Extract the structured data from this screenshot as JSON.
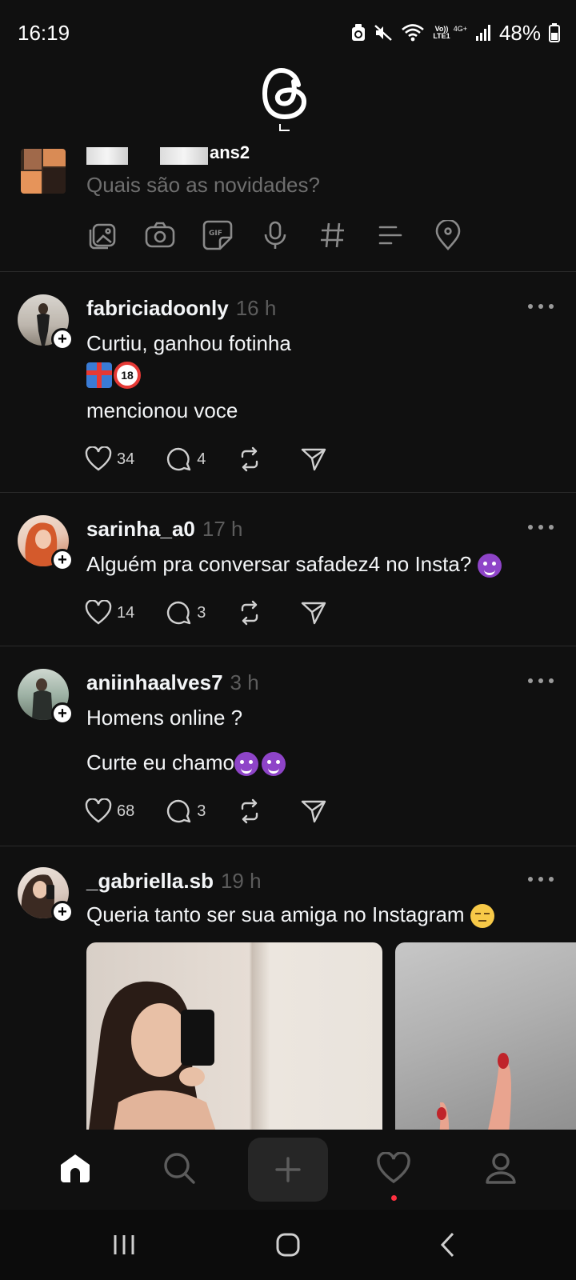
{
  "status_bar": {
    "time": "16:19",
    "network_volte": "Vo))",
    "network_lte": "LTE1",
    "network_4g": "4G+",
    "battery": "48%",
    "icons": [
      "usb-debug-icon",
      "mute-icon",
      "wifi-icon",
      "signal-icon",
      "battery-icon"
    ]
  },
  "app": {
    "logo": "threads-logo"
  },
  "composer": {
    "username_suffix": "ans2",
    "placeholder": "Quais são as novidades?",
    "tools": [
      "image-icon",
      "camera-icon",
      "gif-icon",
      "mic-icon",
      "hashtag-icon",
      "poll-icon",
      "location-icon"
    ]
  },
  "posts": [
    {
      "username": "fabriciadoonly",
      "time": "16 h",
      "lines": [
        "Curtiu, ganhou fotinha",
        "",
        "mencionou voce"
      ],
      "likes": "34",
      "comments": "4"
    },
    {
      "username": "sarinha_a0",
      "time": "17 h",
      "lines": [
        "Alguém pra conversar safadez4 no Insta? "
      ],
      "likes": "14",
      "comments": "3"
    },
    {
      "username": "aniinhaalves7",
      "time": "3 h",
      "lines": [
        "Homens online ?",
        "Curte eu chamo"
      ],
      "likes": "68",
      "comments": "3"
    },
    {
      "username": "_gabriella.sb",
      "time": "19 h",
      "lines": [
        "Queria tanto ser sua amiga no Instagram "
      ]
    }
  ],
  "bottom_nav": [
    "home-icon",
    "search-icon",
    "create-icon",
    "activity-icon",
    "profile-icon"
  ],
  "system_nav": [
    "recents-icon",
    "home-button-icon",
    "back-icon"
  ],
  "colors": {
    "background": "#101010",
    "text": "#f3f5f7",
    "muted": "#6e6e6e",
    "notification": "#ff3040"
  }
}
